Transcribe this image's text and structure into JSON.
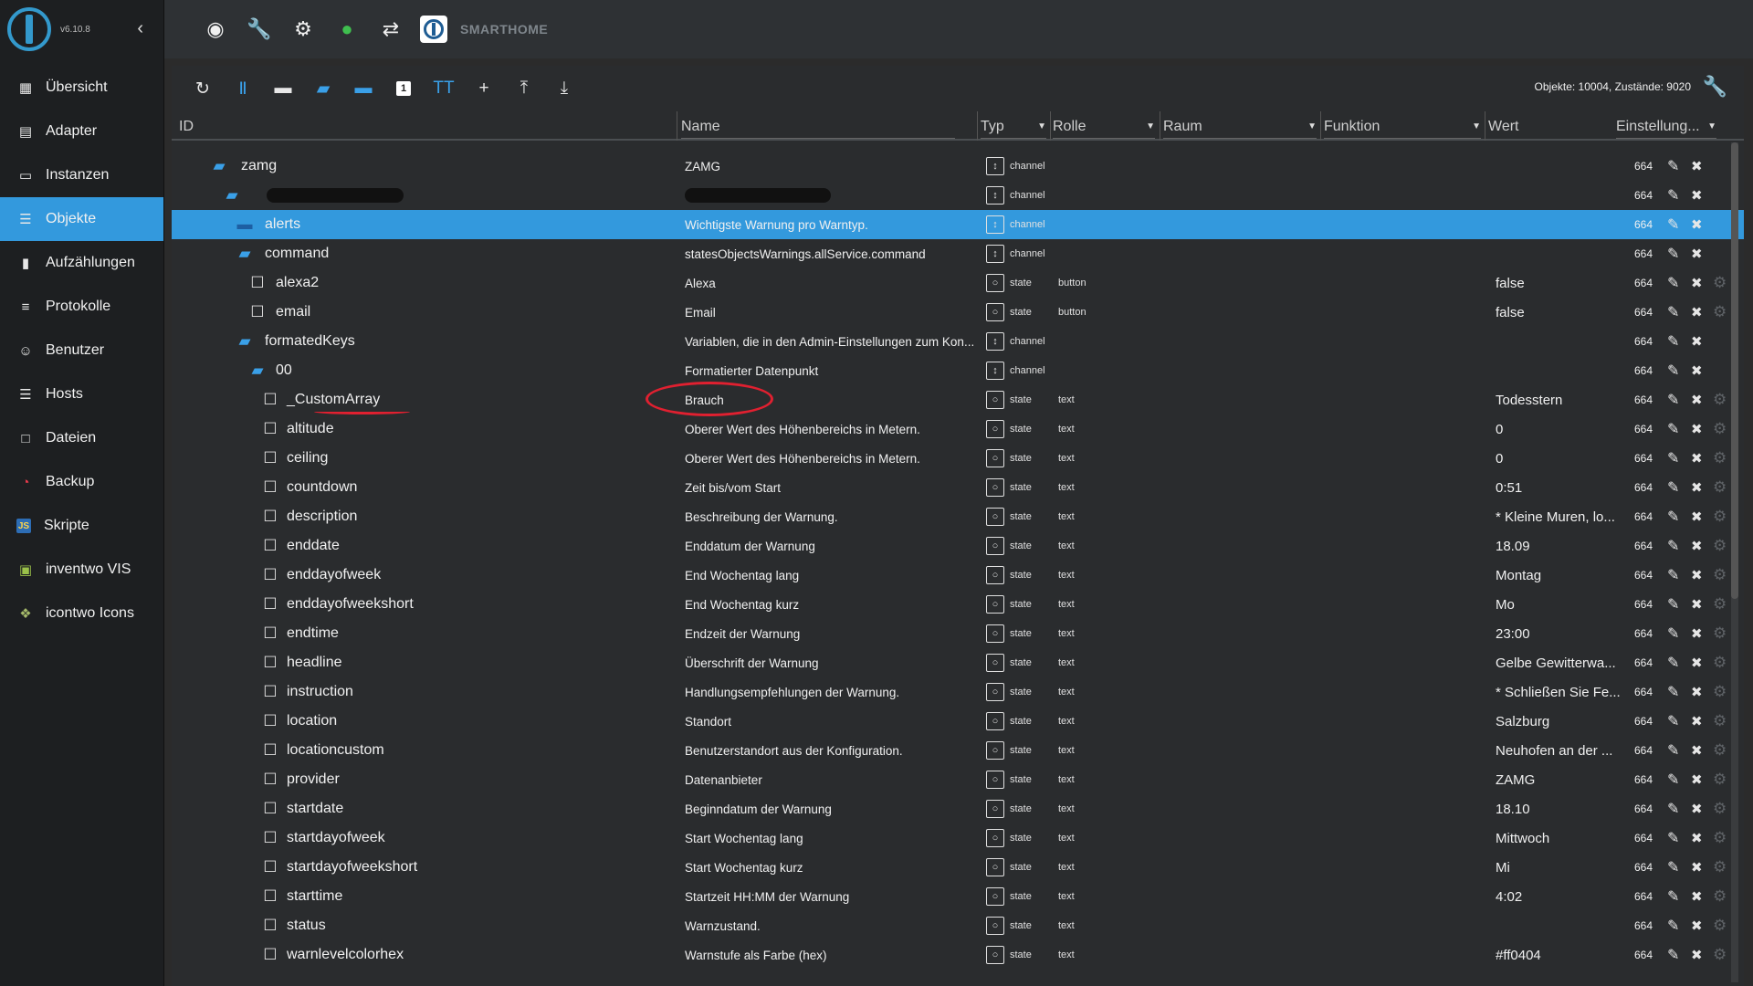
{
  "sidebar": {
    "version": "v6.10.8",
    "items": [
      {
        "label": "Übersicht",
        "icon": "grid-icon"
      },
      {
        "label": "Adapter",
        "icon": "store-icon"
      },
      {
        "label": "Instanzen",
        "icon": "instances-icon"
      },
      {
        "label": "Objekte",
        "icon": "list-icon",
        "active": true
      },
      {
        "label": "Aufzählungen",
        "icon": "enum-icon"
      },
      {
        "label": "Protokolle",
        "icon": "log-icon"
      },
      {
        "label": "Benutzer",
        "icon": "user-icon"
      },
      {
        "label": "Hosts",
        "icon": "hosts-icon"
      },
      {
        "label": "Dateien",
        "icon": "files-icon"
      },
      {
        "label": "Backup",
        "icon": "backup-icon"
      },
      {
        "label": "Skripte",
        "icon": "js-icon"
      },
      {
        "label": "inventwo VIS",
        "icon": "vis-icon"
      },
      {
        "label": "icontwo Icons",
        "icon": "icons-icon"
      }
    ]
  },
  "topbar": {
    "brand": "SMARTHOME",
    "icons": [
      "eye-icon",
      "wrench-icon",
      "gear-icon",
      "brain-icon",
      "sync-off-icon"
    ]
  },
  "toolbar": {
    "counts": "Objekte: 10004, Zustände: 9020",
    "buttons": [
      "refresh-icon",
      "columns-icon",
      "folder-icon",
      "folder-open-icon",
      "folder-closed-icon",
      "expert-icon",
      "text-size-icon",
      "add-icon",
      "upload-icon",
      "download-icon"
    ]
  },
  "columns": {
    "id": "ID",
    "name": "Name",
    "typ": "Typ",
    "rolle": "Rolle",
    "raum": "Raum",
    "funktion": "Funktion",
    "wert": "Wert",
    "einstellung": "Einstellung..."
  },
  "accent": "#3399dd",
  "annotation_color": "#e02030",
  "rows": [
    {
      "id": "zamg",
      "name": "ZAMG",
      "typ": "channel",
      "rolle": "",
      "wert": "",
      "acl": "664",
      "kind": "folder-open",
      "level": 0
    },
    {
      "id": "",
      "name": "",
      "typ": "channel",
      "rolle": "",
      "wert": "",
      "acl": "664",
      "kind": "folder-open",
      "level": 1,
      "redacted": true
    },
    {
      "id": "alerts",
      "name": "Wichtigste Warnung pro Warntyp.",
      "typ": "channel",
      "rolle": "",
      "wert": "",
      "acl": "664",
      "kind": "folder",
      "level": 2,
      "selected": true
    },
    {
      "id": "command",
      "name": "statesObjectsWarnings.allService.command",
      "typ": "channel",
      "rolle": "",
      "wert": "",
      "acl": "664",
      "kind": "folder-open",
      "level": 2
    },
    {
      "id": "alexa2",
      "name": "Alexa",
      "typ": "state",
      "rolle": "button",
      "wert": "false",
      "acl": "664",
      "kind": "file",
      "level": 3
    },
    {
      "id": "email",
      "name": "Email",
      "typ": "state",
      "rolle": "button",
      "wert": "false",
      "acl": "664",
      "kind": "file",
      "level": 3
    },
    {
      "id": "formatedKeys",
      "name": "Variablen, die in den Admin-Einstellungen zum Kon...",
      "typ": "channel",
      "rolle": "",
      "wert": "",
      "acl": "664",
      "kind": "folder-open",
      "level": 2
    },
    {
      "id": "00",
      "name": "Formatierter Datenpunkt",
      "typ": "channel",
      "rolle": "",
      "wert": "",
      "acl": "664",
      "kind": "folder-open",
      "level": 3
    },
    {
      "id": "_CustomArray",
      "name": "Brauch",
      "typ": "state",
      "rolle": "text",
      "wert": "Todesstern",
      "acl": "664",
      "kind": "file",
      "level": 4
    },
    {
      "id": "altitude",
      "name": "Oberer Wert des Höhenbereichs in Metern.",
      "typ": "state",
      "rolle": "text",
      "wert": "0",
      "acl": "664",
      "kind": "file",
      "level": 4
    },
    {
      "id": "ceiling",
      "name": "Oberer Wert des Höhenbereichs in Metern.",
      "typ": "state",
      "rolle": "text",
      "wert": "0",
      "acl": "664",
      "kind": "file",
      "level": 4
    },
    {
      "id": "countdown",
      "name": "Zeit bis/vom Start",
      "typ": "state",
      "rolle": "text",
      "wert": "0:51",
      "acl": "664",
      "kind": "file",
      "level": 4
    },
    {
      "id": "description",
      "name": "Beschreibung der Warnung.",
      "typ": "state",
      "rolle": "text",
      "wert": "* Kleine Muren, lo...",
      "acl": "664",
      "kind": "file",
      "level": 4
    },
    {
      "id": "enddate",
      "name": "Enddatum der Warnung",
      "typ": "state",
      "rolle": "text",
      "wert": "18.09",
      "acl": "664",
      "kind": "file",
      "level": 4
    },
    {
      "id": "enddayofweek",
      "name": "End Wochentag lang",
      "typ": "state",
      "rolle": "text",
      "wert": "Montag",
      "acl": "664",
      "kind": "file",
      "level": 4
    },
    {
      "id": "enddayofweekshort",
      "name": "End Wochentag kurz",
      "typ": "state",
      "rolle": "text",
      "wert": "Mo",
      "acl": "664",
      "kind": "file",
      "level": 4
    },
    {
      "id": "endtime",
      "name": "Endzeit der Warnung",
      "typ": "state",
      "rolle": "text",
      "wert": "23:00",
      "acl": "664",
      "kind": "file",
      "level": 4
    },
    {
      "id": "headline",
      "name": "Überschrift der Warnung",
      "typ": "state",
      "rolle": "text",
      "wert": "Gelbe Gewitterwa...",
      "acl": "664",
      "kind": "file",
      "level": 4
    },
    {
      "id": "instruction",
      "name": "Handlungsempfehlungen der Warnung.",
      "typ": "state",
      "rolle": "text",
      "wert": "* Schließen Sie Fe...",
      "acl": "664",
      "kind": "file",
      "level": 4
    },
    {
      "id": "location",
      "name": "Standort",
      "typ": "state",
      "rolle": "text",
      "wert": "Salzburg",
      "acl": "664",
      "kind": "file",
      "level": 4
    },
    {
      "id": "locationcustom",
      "name": "Benutzerstandort aus der Konfiguration.",
      "typ": "state",
      "rolle": "text",
      "wert": "Neuhofen an der ...",
      "acl": "664",
      "kind": "file",
      "level": 4
    },
    {
      "id": "provider",
      "name": "Datenanbieter",
      "typ": "state",
      "rolle": "text",
      "wert": "ZAMG",
      "acl": "664",
      "kind": "file",
      "level": 4
    },
    {
      "id": "startdate",
      "name": "Beginndatum der Warnung",
      "typ": "state",
      "rolle": "text",
      "wert": "18.10",
      "acl": "664",
      "kind": "file",
      "level": 4
    },
    {
      "id": "startdayofweek",
      "name": "Start Wochentag lang",
      "typ": "state",
      "rolle": "text",
      "wert": "Mittwoch",
      "acl": "664",
      "kind": "file",
      "level": 4
    },
    {
      "id": "startdayofweekshort",
      "name": "Start Wochentag kurz",
      "typ": "state",
      "rolle": "text",
      "wert": "Mi",
      "acl": "664",
      "kind": "file",
      "level": 4
    },
    {
      "id": "starttime",
      "name": "Startzeit HH:MM der Warnung",
      "typ": "state",
      "rolle": "text",
      "wert": "4:02",
      "acl": "664",
      "kind": "file",
      "level": 4
    },
    {
      "id": "status",
      "name": "Warnzustand.",
      "typ": "state",
      "rolle": "text",
      "wert": "",
      "acl": "664",
      "kind": "file",
      "level": 4
    },
    {
      "id": "warnlevelcolorhex",
      "name": "Warnstufe als Farbe (hex)",
      "typ": "state",
      "rolle": "text",
      "wert": "#ff0404",
      "acl": "664",
      "kind": "file",
      "level": 4
    }
  ]
}
